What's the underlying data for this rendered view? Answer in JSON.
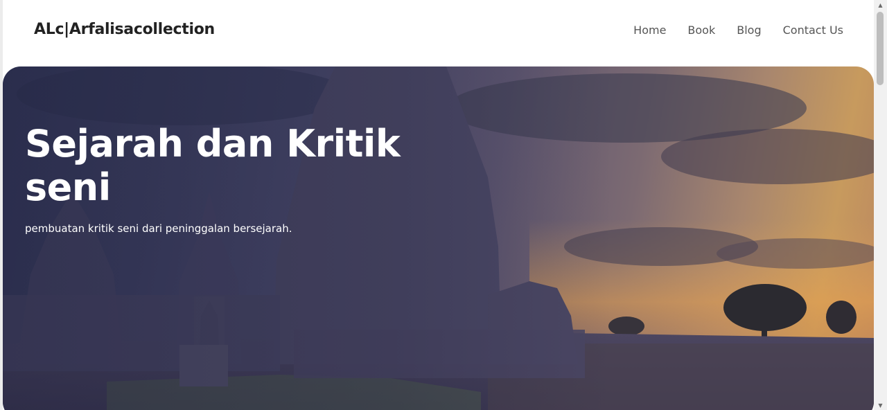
{
  "header": {
    "brand": "ALc|Arfalisacollection",
    "nav": [
      "Home",
      "Book",
      "Blog",
      "Contact Us"
    ]
  },
  "hero": {
    "title": "Sejarah dan Kritik seni",
    "subtitle": "pembuatan kritik seni dari peninggalan bersejarah.",
    "image": "temple-sunset-image"
  },
  "scrollbar": {
    "up_glyph": "▲",
    "down_glyph": "▼"
  },
  "colors": {
    "brand_text": "#222222",
    "nav_text": "#555555",
    "hero_text": "#ffffff",
    "sky_dark": "#34385a",
    "sunset": "#c79a5e"
  }
}
